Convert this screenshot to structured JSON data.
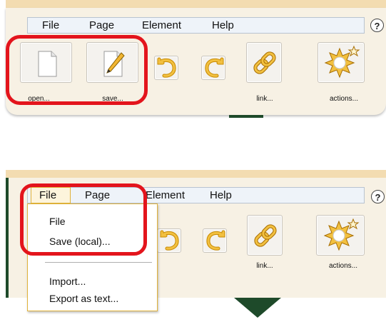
{
  "menubar": {
    "items": [
      "File",
      "Page",
      "Element",
      "Help"
    ],
    "help_glyph": "?"
  },
  "toolbar": {
    "open_label": "open...",
    "save_label": "save...",
    "link_label": "link...",
    "actions_label": "actions..."
  },
  "file_menu": {
    "items": [
      "File",
      "Save (local)...",
      "Import...",
      "Export as text..."
    ]
  },
  "icons": {
    "open": "document-icon",
    "save": "pencil-icon",
    "undo": "undo-icon",
    "redo": "redo-icon",
    "link": "chain-link-icon",
    "actions": "starburst-icon",
    "help": "help-icon"
  },
  "colors": {
    "highlight": "#e3141c",
    "accent_gold": "#e0b23a",
    "panel_bg": "#f7f1e4",
    "dark_green": "#1e4a2a"
  }
}
